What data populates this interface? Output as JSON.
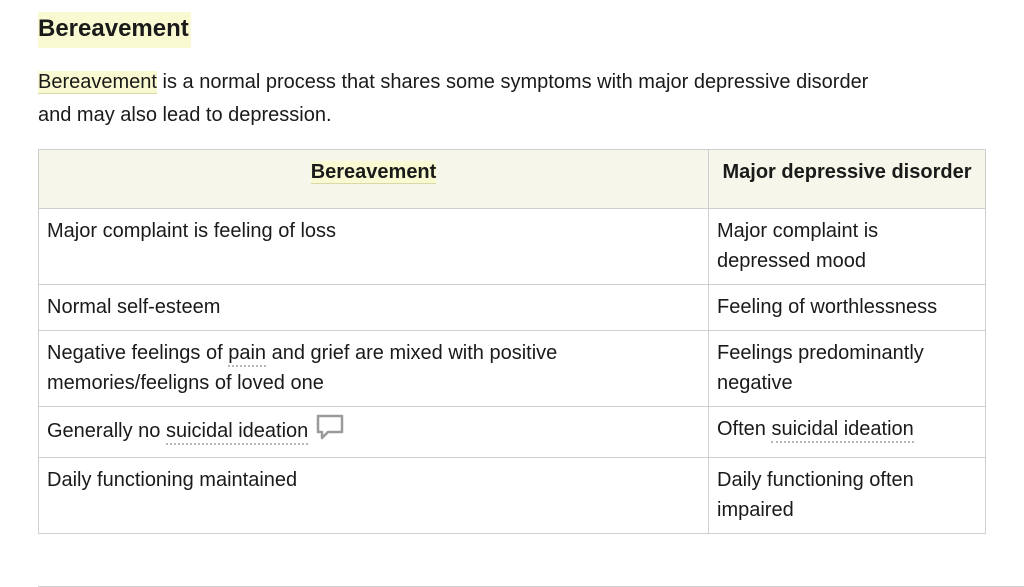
{
  "section": {
    "title": "Bereavement",
    "intro_link": "Bereavement",
    "intro_rest_line1": " is a normal process that shares some symptoms with major depressive disorder",
    "intro_rest_line2": "and may also lead to depression."
  },
  "table": {
    "headers": [
      "Bereavement",
      "Major depressive disorder"
    ],
    "rows": [
      {
        "left": "Major complaint is feeling of loss",
        "right": "Major complaint is depressed mood"
      },
      {
        "left": "Normal self-esteem",
        "right": "Feeling of worthlessness"
      },
      {
        "left_pre": "Negative feelings of ",
        "left_term": "pain",
        "left_post": " and grief are mixed with positive memories/feeligns of loved one",
        "right": "Feelings predominantly negative"
      },
      {
        "left_pre": "Generally no ",
        "left_term": "suicidal ideation",
        "right_pre": "Often ",
        "right_term": "suicidal ideation"
      },
      {
        "left": "Daily functioning maintained",
        "right": "Daily functioning often impaired"
      }
    ]
  },
  "icons": {
    "comment": "comment-icon"
  },
  "colors": {
    "highlight": "#fafad2",
    "header_bg": "#f6f6ea",
    "border": "#cfcfcf"
  }
}
